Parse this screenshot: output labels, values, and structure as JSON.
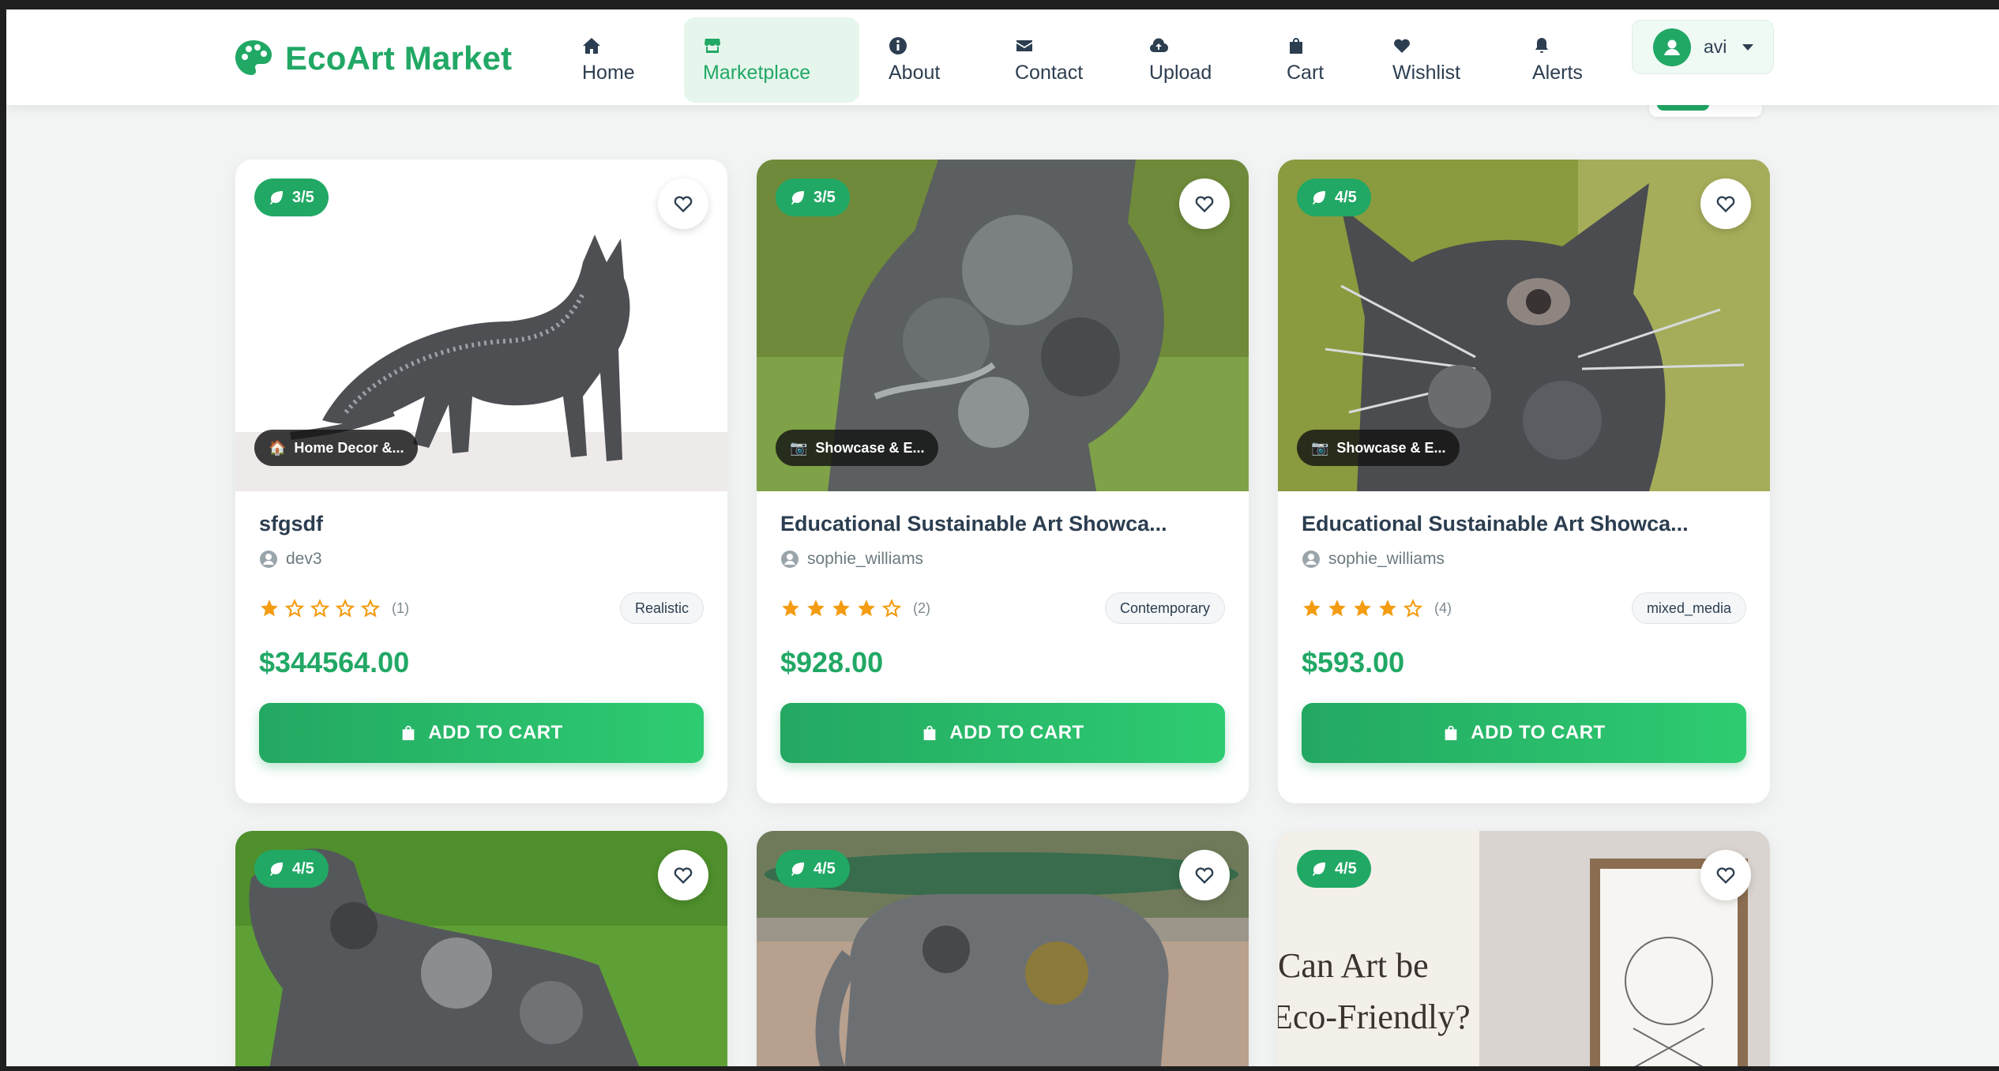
{
  "brand": {
    "name": "EcoArt Market",
    "accent": "#21a865"
  },
  "nav": {
    "items": [
      {
        "label": "Home",
        "icon": "home-icon"
      },
      {
        "label": "Marketplace",
        "icon": "store-icon",
        "active": true
      },
      {
        "label": "About",
        "icon": "info-icon"
      },
      {
        "label": "Contact",
        "icon": "envelope-icon"
      },
      {
        "label": "Upload",
        "icon": "cloud-upload-icon"
      },
      {
        "label": "Cart",
        "icon": "shopping-bag-icon"
      },
      {
        "label": "Wishlist",
        "icon": "heart-icon"
      },
      {
        "label": "Alerts",
        "icon": "bell-icon"
      }
    ],
    "user": {
      "name": "avi",
      "icon": "user-circle-icon"
    }
  },
  "cards": [
    {
      "eco_score": "3/5",
      "category": "Home Decor &...",
      "title": "sfgsdf",
      "artist": "dev3",
      "rating": 1,
      "rating_count": "(1)",
      "style": "Realistic",
      "price": "$344564.00",
      "cta": "ADD TO CART"
    },
    {
      "eco_score": "3/5",
      "category": "Showcase & E...",
      "title": "Educational Sustainable Art Showca...",
      "artist": "sophie_williams",
      "rating": 4,
      "rating_count": "(2)",
      "style": "Contemporary",
      "price": "$928.00",
      "cta": "ADD TO CART"
    },
    {
      "eco_score": "4/5",
      "category": "Showcase & E...",
      "title": "Educational Sustainable Art Showca...",
      "artist": "sophie_williams",
      "rating": 4,
      "rating_count": "(4)",
      "style": "mixed_media",
      "price": "$593.00",
      "cta": "ADD TO CART"
    },
    {
      "eco_score": "4/5"
    },
    {
      "eco_score": "4/5"
    },
    {
      "eco_score": "4/5",
      "image_text_1": "Can Art be",
      "image_text_2": "Eco-Friendly?"
    }
  ]
}
